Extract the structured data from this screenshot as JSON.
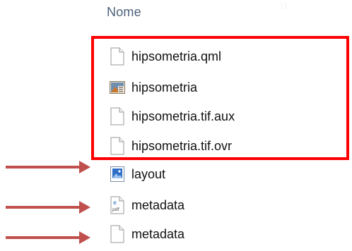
{
  "header": {
    "column_name": "Nome"
  },
  "files": [
    {
      "name": "hipsometria.qml",
      "icon": "blank-file-icon"
    },
    {
      "name": "hipsometria",
      "icon": "raster-image-icon"
    },
    {
      "name": "hipsometria.tif.aux",
      "icon": "blank-file-icon"
    },
    {
      "name": "hipsometria.tif.ovr",
      "icon": "blank-file-icon"
    },
    {
      "name": "layout",
      "icon": "image-file-icon"
    },
    {
      "name": "metadata",
      "icon": "pdf-file-icon"
    },
    {
      "name": "metadata",
      "icon": "blank-file-icon"
    }
  ],
  "annotations": {
    "highlight_color": "#ff0000",
    "arrow_color": "#c0504d"
  }
}
